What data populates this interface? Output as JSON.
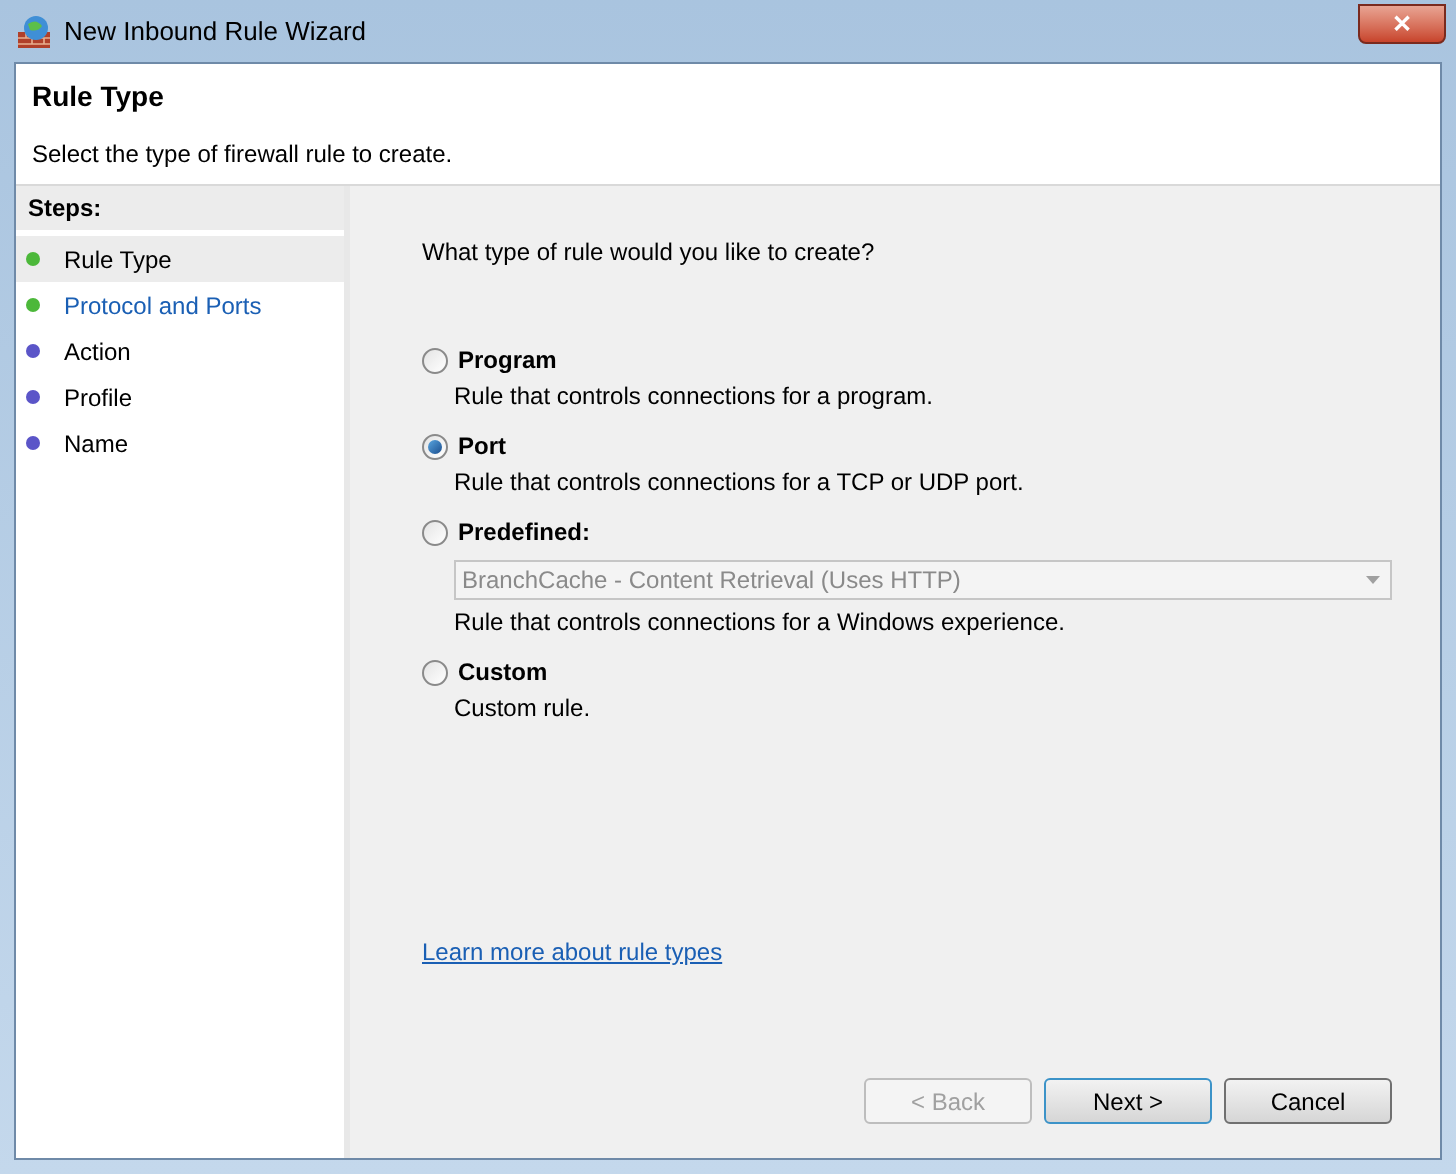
{
  "window": {
    "title": "New Inbound Rule Wizard",
    "close": "✕"
  },
  "header": {
    "title": "Rule Type",
    "subtitle": "Select the type of firewall rule to create."
  },
  "steps": {
    "heading": "Steps:",
    "items": [
      {
        "label": "Rule Type",
        "selected": true,
        "kind": "text",
        "color": "#4cb83a"
      },
      {
        "label": "Protocol and Ports",
        "selected": false,
        "kind": "link",
        "color": "#4cb83a"
      },
      {
        "label": "Action",
        "selected": false,
        "kind": "text",
        "color": "#5b55c8"
      },
      {
        "label": "Profile",
        "selected": false,
        "kind": "text",
        "color": "#5b55c8"
      },
      {
        "label": "Name",
        "selected": false,
        "kind": "text",
        "color": "#5b55c8"
      }
    ]
  },
  "question": "What type of rule would you like to create?",
  "options": [
    {
      "label": "Program",
      "description": "Rule that controls connections for a program.",
      "selected": false
    },
    {
      "label": "Port",
      "description": "Rule that controls connections for a TCP or UDP port.",
      "selected": true
    },
    {
      "label": "Predefined:",
      "description": "Rule that controls connections for a Windows experience.",
      "selected": false,
      "dropdown": {
        "value": "BranchCache - Content Retrieval (Uses HTTP)",
        "disabled": true
      }
    },
    {
      "label": "Custom",
      "description": "Custom rule.",
      "selected": false
    }
  ],
  "learn_more": "Learn more about rule types",
  "buttons": [
    {
      "label": "< Back",
      "disabled": true,
      "default": false
    },
    {
      "label": "Next >",
      "disabled": false,
      "default": true
    },
    {
      "label": "Cancel",
      "disabled": false,
      "default": false
    }
  ]
}
